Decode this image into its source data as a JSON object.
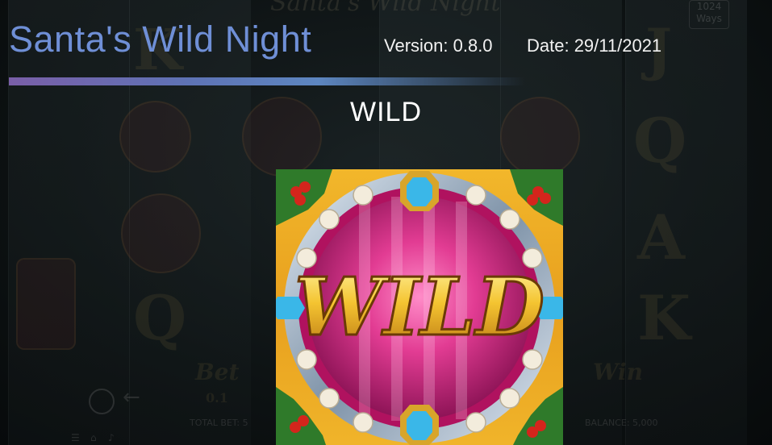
{
  "game": {
    "title": "Santa's Wild Night",
    "version": "Version: 0.8.0",
    "date": "Date: 29/11/2021"
  },
  "symbol": {
    "name": "WILD",
    "artwork_text": "WILD"
  },
  "background": {
    "title": "Santa's Wild Night",
    "ways": "1024",
    "ways_label": "Ways",
    "bet_label": "Bet",
    "bet_value": "0.1",
    "total_bet": "TOTAL BET: 5",
    "win_label": "Win",
    "balance": "BALANCE: 5,000"
  },
  "colors": {
    "title": "#6f8fd6",
    "divider_start": "#7a5fa8",
    "divider_end": "#5d86c0",
    "tile_gold": "#f2b72b",
    "tile_pink": "#e8378f",
    "gem_blue": "#3ab7e8"
  }
}
